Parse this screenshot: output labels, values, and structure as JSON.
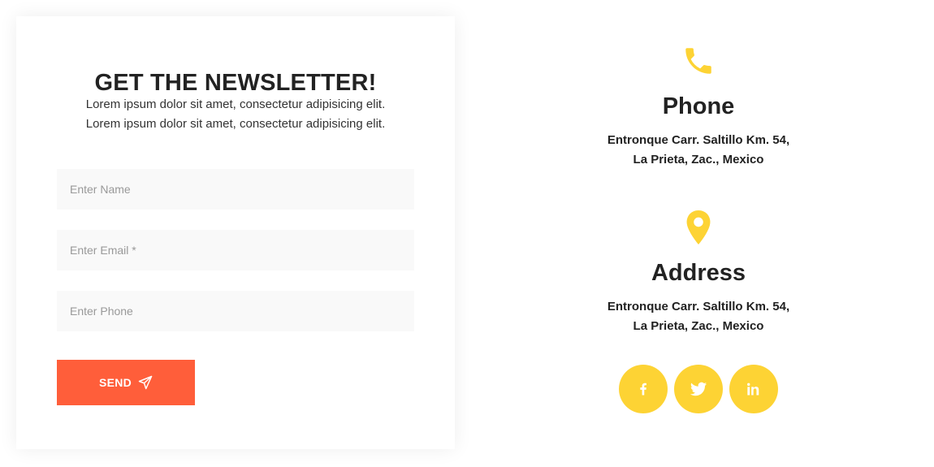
{
  "newsletter": {
    "title": "GET THE NEWSLETTER!",
    "description": [
      "Lorem ipsum dolor sit amet, consectetur adipisicing elit.",
      "Lorem ipsum dolor sit amet, consectetur adipisicing elit."
    ],
    "fields": {
      "name": {
        "value": "",
        "placeholder": "Enter Name"
      },
      "email": {
        "value": "",
        "placeholder": "Enter Email *"
      },
      "phone": {
        "value": "",
        "placeholder": "Enter Phone"
      }
    },
    "send_button": {
      "label": "SEND",
      "icon": "paper-plane-icon"
    }
  },
  "contact": {
    "phone": {
      "icon": "phone-icon",
      "heading": "Phone",
      "lines": [
        "Entronque Carr. Saltillo Km. 54,",
        "La Prieta, Zac., Mexico"
      ]
    },
    "address": {
      "icon": "map-pin-icon",
      "heading": "Address",
      "lines": [
        "Entronque Carr. Saltillo Km. 54,",
        "La Prieta, Zac., Mexico"
      ]
    },
    "socials": [
      {
        "name": "facebook",
        "icon": "facebook-icon"
      },
      {
        "name": "twitter",
        "icon": "twitter-icon"
      },
      {
        "name": "linkedin",
        "icon": "linkedin-icon"
      }
    ]
  },
  "colors": {
    "accent_yellow": "#fdd334",
    "send_button": "#ff5e3a",
    "field_background": "#f9f9f9",
    "text_dark": "#222222"
  }
}
